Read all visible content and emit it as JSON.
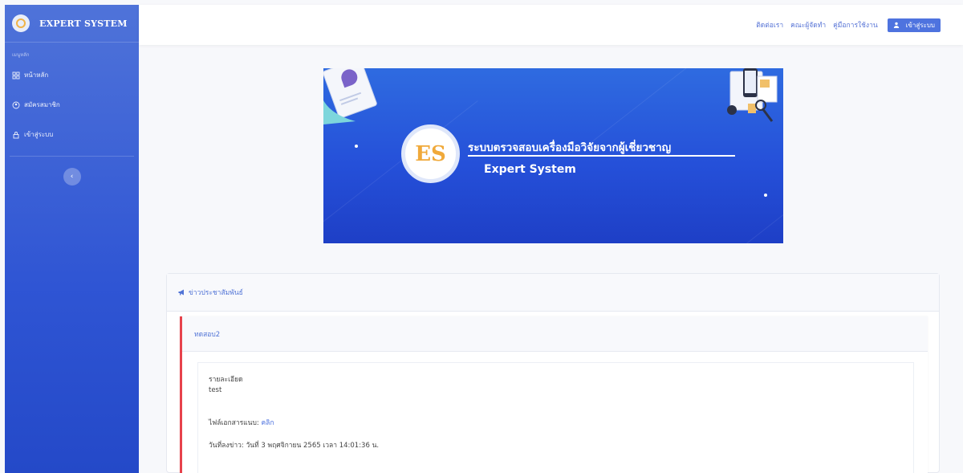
{
  "brand": {
    "title": "EXPERT SYSTEM"
  },
  "sidebar": {
    "heading": "เมนูหลัก",
    "items": [
      {
        "label": "หน้าหลัก",
        "icon": "home-icon"
      },
      {
        "label": "สมัครสมาชิก",
        "icon": "user-plus-icon"
      },
      {
        "label": "เข้าสู่ระบบ",
        "icon": "login-icon"
      }
    ],
    "toggle_icon": "chevron-left-icon"
  },
  "topbar": {
    "links": [
      "ติดต่อเรา",
      "คณะผู้จัดทำ",
      "คู่มือการใช้งาน"
    ],
    "login_button": "เข้าสู่ระบบ"
  },
  "banner": {
    "logo_text": "ES",
    "title": "ระบบตรวจสอบเครื่องมือวิจัยจากผู้เชี่ยวชาญ",
    "subtitle": "Expert System"
  },
  "news": {
    "header": "ข่าวประชาสัมพันธ์",
    "item": {
      "title": "ทดสอบ2",
      "detail_label": "รายละเอียด",
      "detail_value": "test",
      "attachment_label": "ไฟล์เอกสารแนบ:",
      "attachment_link": "คลิก",
      "posted": "วันที่ลงข่าว: วันที่ 3 พฤศจิกายน 2565 เวลา 14:01:36 น."
    }
  },
  "colors": {
    "sidebar": "#2f55d4",
    "accent": "#4e73df",
    "news_border": "#e7424b"
  }
}
